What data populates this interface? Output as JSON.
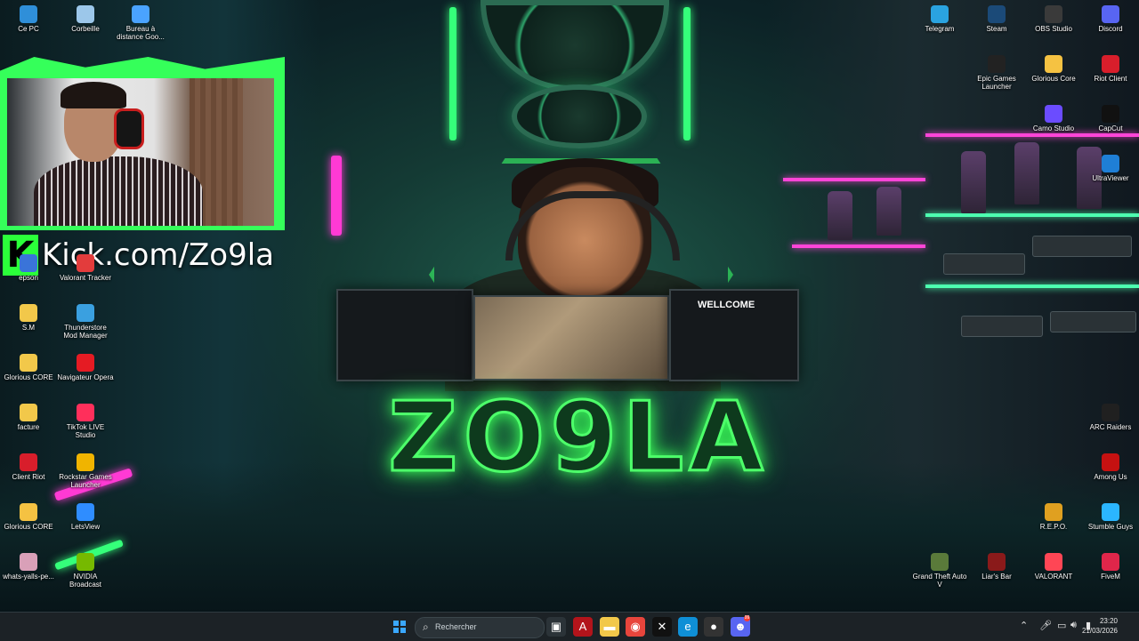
{
  "wallpaper": {
    "brand_text": "ZO9LA",
    "monitor_text": "WELLCOME",
    "accent": "#35ff7a",
    "accent2": "#ff3ad4"
  },
  "overlay": {
    "kick_logo": "K",
    "kick_url": "Kick.com/Zo9la"
  },
  "desktop_left": [
    {
      "label": "Ce PC",
      "icon": "computer-icon",
      "color": "#2f8fd9"
    },
    {
      "label": "Corbeille",
      "icon": "recycle-bin-icon",
      "color": "#9cc7ea"
    },
    {
      "label": "Bureau à distance Goo...",
      "icon": "remote-desktop-icon",
      "color": "#4aa3ff"
    },
    {
      "label": "epson",
      "icon": "printer-icon",
      "color": "#3a74d9"
    },
    {
      "label": "Valorant Tracker",
      "icon": "tracker-icon",
      "color": "#e33c3c"
    },
    {
      "label": "S.M",
      "icon": "folder-icon",
      "color": "#f2c84a"
    },
    {
      "label": "Thunderstore Mod Manager",
      "icon": "thunderstore-icon",
      "color": "#3aa0e0"
    },
    {
      "label": "Glorious CORE",
      "icon": "folder-icon",
      "color": "#f2c84a"
    },
    {
      "label": "Navigateur Opera",
      "icon": "opera-icon",
      "color": "#e51b23"
    },
    {
      "label": "facture",
      "icon": "folder-icon",
      "color": "#f2c84a"
    },
    {
      "label": "TikTok LIVE Studio",
      "icon": "tiktok-icon",
      "color": "#ff2f5b"
    },
    {
      "label": "Client Riot",
      "icon": "riot-icon",
      "color": "#d81e2b"
    },
    {
      "label": "Rockstar Games Launcher",
      "icon": "rockstar-icon",
      "color": "#f0b400"
    },
    {
      "label": "Glorious CORE",
      "icon": "glorious-icon",
      "color": "#f5c242"
    },
    {
      "label": "LetsView",
      "icon": "letsview-icon",
      "color": "#2f8dff"
    },
    {
      "label": "whats-yalls-pe...",
      "icon": "image-file-icon",
      "color": "#d9a0b8"
    },
    {
      "label": "NVIDIA Broadcast",
      "icon": "nvidia-icon",
      "color": "#76b900"
    }
  ],
  "desktop_right": [
    {
      "label": "Telegram",
      "icon": "telegram-icon",
      "color": "#2aa3e0"
    },
    {
      "label": "Steam",
      "icon": "steam-icon",
      "color": "#1b4a78"
    },
    {
      "label": "OBS Studio",
      "icon": "obs-icon",
      "color": "#3a3a3a"
    },
    {
      "label": "Discord",
      "icon": "discord-icon",
      "color": "#5865f2"
    },
    {
      "label": "Epic Games Launcher",
      "icon": "epic-icon",
      "color": "#222222"
    },
    {
      "label": "Glorious Core",
      "icon": "glorious-icon",
      "color": "#f5c242"
    },
    {
      "label": "Riot Client",
      "icon": "riot-icon",
      "color": "#d81e2b"
    },
    {
      "label": "Camo Studio",
      "icon": "camo-icon",
      "color": "#6b4cff"
    },
    {
      "label": "CapCut",
      "icon": "capcut-icon",
      "color": "#111111"
    },
    {
      "label": "UltraViewer",
      "icon": "ultraviewer-icon",
      "color": "#1f7fd6"
    },
    {
      "label": "ARC Raiders",
      "icon": "arc-raiders-icon",
      "color": "#202020"
    },
    {
      "label": "Among Us",
      "icon": "among-us-icon",
      "color": "#c51111"
    },
    {
      "label": "R.E.P.O.",
      "icon": "repo-icon",
      "color": "#e0a020"
    },
    {
      "label": "Stumble Guys",
      "icon": "stumble-guys-icon",
      "color": "#2bb6ff"
    },
    {
      "label": "Grand Theft Auto V",
      "icon": "gta-icon",
      "color": "#5a7a3a"
    },
    {
      "label": "Liar's Bar",
      "icon": "liars-bar-icon",
      "color": "#8a1a1a"
    },
    {
      "label": "VALORANT",
      "icon": "valorant-icon",
      "color": "#ff4655"
    },
    {
      "label": "FiveM",
      "icon": "fivem-icon",
      "color": "#e0264a"
    }
  ],
  "taskbar": {
    "search_placeholder": "Rechercher",
    "apps": [
      {
        "name": "task-view-icon",
        "glyph": "▣",
        "color": "#2b3338"
      },
      {
        "name": "acrobat-icon",
        "glyph": "A",
        "color": "#b3141b"
      },
      {
        "name": "file-explorer-icon",
        "glyph": "▬",
        "color": "#f2c84a"
      },
      {
        "name": "chrome-icon",
        "glyph": "◉",
        "color": "#e8453c"
      },
      {
        "name": "capcut-icon",
        "glyph": "✕",
        "color": "#111111"
      },
      {
        "name": "edge-icon",
        "glyph": "e",
        "color": "#0f8fd6"
      },
      {
        "name": "obs-icon",
        "glyph": "●",
        "color": "#333333"
      },
      {
        "name": "discord-icon",
        "glyph": "☻",
        "color": "#5865f2"
      }
    ],
    "discord_badge": "99",
    "time": "23:20",
    "date": "21/03/2026"
  }
}
